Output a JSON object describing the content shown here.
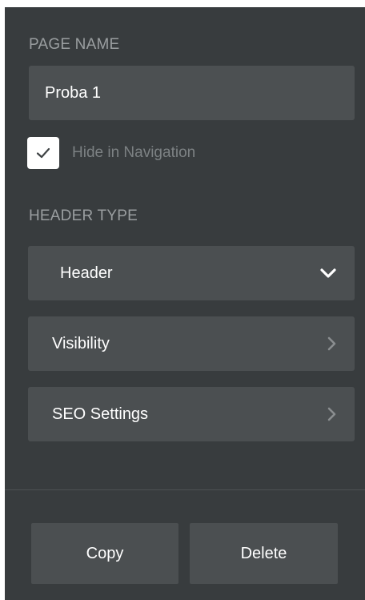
{
  "page_settings": {
    "page_name_label": "PAGE NAME",
    "page_name_value": "Proba 1",
    "hide_in_navigation": {
      "label": "Hide in Navigation",
      "checked": true
    },
    "header_type_label": "HEADER TYPE",
    "header_type_value": "Header",
    "visibility_label": "Visibility",
    "seo_settings_label": "SEO Settings"
  },
  "actions": {
    "copy_label": "Copy",
    "delete_label": "Delete"
  },
  "icons": {
    "checkbox": "checkmark-icon",
    "header_dropdown": "chevron-down-icon",
    "visibility": "chevron-right-icon",
    "seo": "chevron-right-icon"
  },
  "colors": {
    "panel_bg": "#383c3e",
    "field_bg": "#4c5052",
    "label_text": "#9a9ea0",
    "muted_text": "#7c8183",
    "primary_text": "#ffffff"
  }
}
